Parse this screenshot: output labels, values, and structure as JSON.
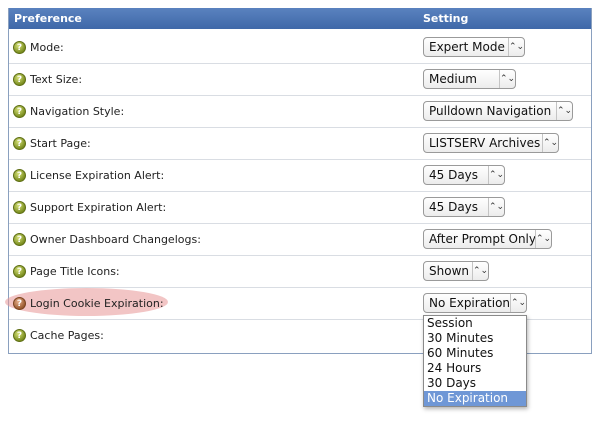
{
  "header": {
    "preference_label": "Preference",
    "setting_label": "Setting"
  },
  "rows": [
    {
      "label": "Mode:",
      "value": "Expert Mode"
    },
    {
      "label": "Text Size:",
      "value": "Medium"
    },
    {
      "label": "Navigation Style:",
      "value": "Pulldown Navigation"
    },
    {
      "label": "Start Page:",
      "value": "LISTSERV Archives"
    },
    {
      "label": "License Expiration Alert:",
      "value": "45 Days"
    },
    {
      "label": "Support Expiration Alert:",
      "value": "45 Days"
    },
    {
      "label": "Owner Dashboard Changelogs:",
      "value": "After Prompt Only"
    },
    {
      "label": "Page Title Icons:",
      "value": "Shown"
    },
    {
      "label": "Login Cookie Expiration:",
      "value": "No Expiration"
    },
    {
      "label": "Cache Pages:",
      "value": ""
    }
  ],
  "help_icon_glyph": "?",
  "select_arrow_glyph": "⌃⌄",
  "dropdown": {
    "options": [
      "Session",
      "30 Minutes",
      "60 Minutes",
      "24 Hours",
      "30 Days",
      "No Expiration"
    ],
    "selected_index": 5
  },
  "colors": {
    "header_bg": "#4a72b0",
    "highlight": "#e89696",
    "selected_option": "#6f97d6"
  }
}
